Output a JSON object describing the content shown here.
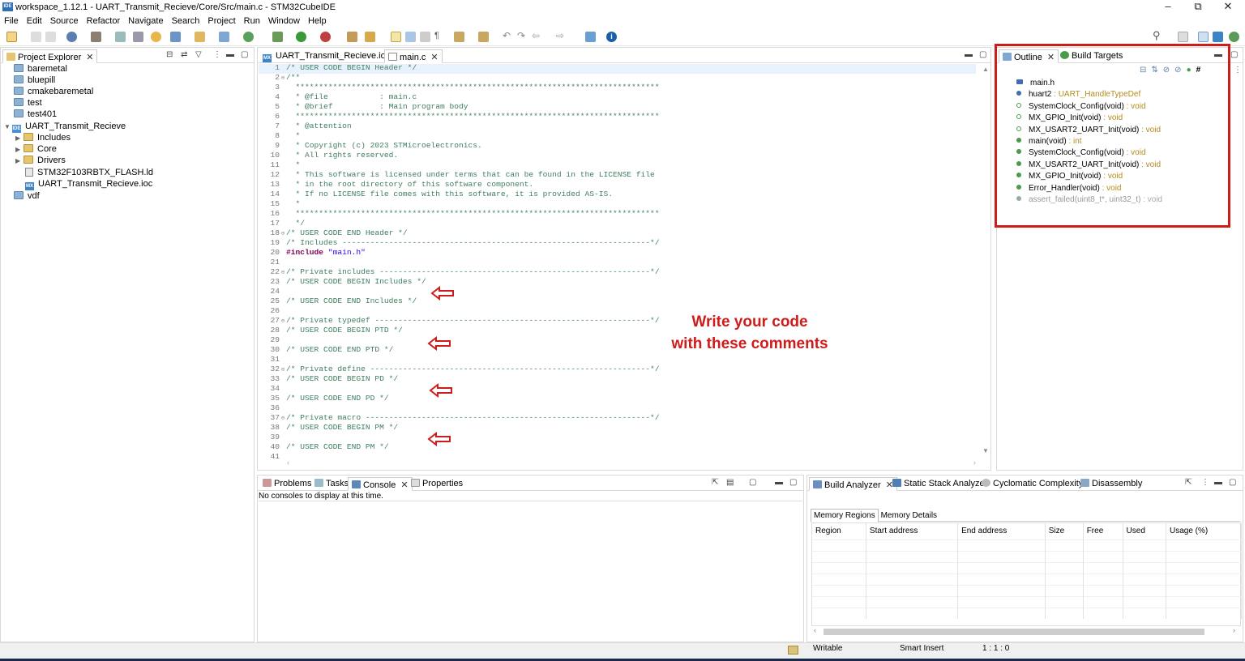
{
  "window": {
    "title": "workspace_1.12.1 - UART_Transmit_Recieve/Core/Src/main.c - STM32CubeIDE",
    "app_icon_text": "IDE"
  },
  "menu": [
    "File",
    "Edit",
    "Source",
    "Refactor",
    "Navigate",
    "Search",
    "Project",
    "Run",
    "Window",
    "Help"
  ],
  "project_explorer": {
    "tab_label": "Project Explorer",
    "items": [
      {
        "label": "baremetal",
        "level": 0,
        "kind": "project"
      },
      {
        "label": "bluepill",
        "level": 0,
        "kind": "project"
      },
      {
        "label": "cmakebaremetal",
        "level": 0,
        "kind": "project"
      },
      {
        "label": "test",
        "level": 0,
        "kind": "project"
      },
      {
        "label": "test401",
        "level": 0,
        "kind": "project"
      },
      {
        "label": "UART_Transmit_Recieve",
        "level": 0,
        "kind": "ide-project"
      },
      {
        "label": "Includes",
        "level": 1,
        "kind": "folder"
      },
      {
        "label": "Core",
        "level": 1,
        "kind": "folder"
      },
      {
        "label": "Drivers",
        "level": 1,
        "kind": "folder"
      },
      {
        "label": "STM32F103RBTX_FLASH.ld",
        "level": 1,
        "kind": "file"
      },
      {
        "label": "UART_Transmit_Recieve.ioc",
        "level": 1,
        "kind": "mx"
      },
      {
        "label": "vdf",
        "level": 0,
        "kind": "project"
      }
    ]
  },
  "editor": {
    "tabs": [
      {
        "label": "UART_Transmit_Recieve.ioc",
        "icon": "MX"
      },
      {
        "label": "main.c",
        "icon": "c-file"
      }
    ],
    "lines": [
      "/* USER CODE BEGIN Header */",
      "/**",
      "  ******************************************************************************",
      "  * @file           : main.c",
      "  * @brief          : Main program body",
      "  ******************************************************************************",
      "  * @attention",
      "  *",
      "  * Copyright (c) 2023 STMicroelectronics.",
      "  * All rights reserved.",
      "  *",
      "  * This software is licensed under terms that can be found in the LICENSE file",
      "  * in the root directory of this software component.",
      "  * If no LICENSE file comes with this software, it is provided AS-IS.",
      "  *",
      "  ******************************************************************************",
      "  */",
      "/* USER CODE END Header */",
      "/* Includes ------------------------------------------------------------------*/",
      "#include \"main.h\"",
      "",
      "/* Private includes ----------------------------------------------------------*/",
      "/* USER CODE BEGIN Includes */",
      "",
      "/* USER CODE END Includes */",
      "",
      "/* Private typedef -----------------------------------------------------------*/",
      "/* USER CODE BEGIN PTD */",
      "",
      "/* USER CODE END PTD */",
      "",
      "/* Private define ------------------------------------------------------------*/",
      "/* USER CODE BEGIN PD */",
      "",
      "/* USER CODE END PD */",
      "",
      "/* Private macro -------------------------------------------------------------*/",
      "/* USER CODE BEGIN PM */",
      "",
      "/* USER CODE END PM */",
      ""
    ],
    "fold_lines": [
      2,
      18,
      22,
      27,
      32,
      37
    ],
    "annotation_line1": "Write your code",
    "annotation_line2": "with these comments"
  },
  "outline": {
    "tabs": [
      "Outline",
      "Build Targets"
    ],
    "items": [
      {
        "name": "main.h",
        "type": "",
        "icon": "include"
      },
      {
        "name": "huart2",
        "type": " : UART_HandleTypeDef",
        "icon": "variable"
      },
      {
        "name": "SystemClock_Config(void)",
        "type": " : void",
        "icon": "declaration"
      },
      {
        "name": "MX_GPIO_Init(void)",
        "type": " : void",
        "icon": "static-declaration"
      },
      {
        "name": "MX_USART2_UART_Init(void)",
        "type": " : void",
        "icon": "static-declaration"
      },
      {
        "name": "main(void)",
        "type": " : int",
        "icon": "function"
      },
      {
        "name": "SystemClock_Config(void)",
        "type": " : void",
        "icon": "function"
      },
      {
        "name": "MX_USART2_UART_Init(void)",
        "type": " : void",
        "icon": "static-function"
      },
      {
        "name": "MX_GPIO_Init(void)",
        "type": " : void",
        "icon": "static-function"
      },
      {
        "name": "Error_Handler(void)",
        "type": " : void",
        "icon": "function"
      },
      {
        "name": "assert_failed(uint8_t*, uint32_t)",
        "type": " : void",
        "icon": "inactive-function"
      }
    ]
  },
  "console": {
    "tabs": [
      "Problems",
      "Tasks",
      "Console",
      "Properties"
    ],
    "message": "No consoles to display at this time."
  },
  "build_analyzer": {
    "tabs": [
      "Build Analyzer",
      "Static Stack Analyzer",
      "Cyclomatic Complexity",
      "Disassembly"
    ],
    "subtabs": [
      "Memory Regions",
      "Memory Details"
    ],
    "columns": [
      "Region",
      "Start address",
      "End address",
      "Size",
      "Free",
      "Used",
      "Usage (%)"
    ]
  },
  "statusbar": {
    "writable": "Writable",
    "insert_mode": "Smart Insert",
    "position": "1 : 1 : 0"
  },
  "colors": {
    "highlight_box": "#d01b1b",
    "comment": "#3f7f5f",
    "keyword": "#7f0055",
    "string": "#2a00ff"
  }
}
